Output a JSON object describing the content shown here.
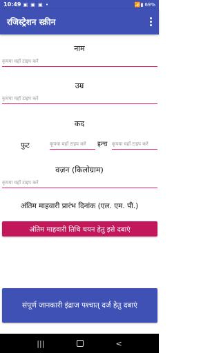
{
  "status_bar": {
    "time": "10:49",
    "left_icons": "▣ ▣ ▣ •",
    "right_icons": "📶▮",
    "battery": "69%"
  },
  "app_bar": {
    "title": "रजिस्ट्रेशन स्क्रीन"
  },
  "form": {
    "name_label": "नाम",
    "name_placeholder": "कृपया यहाँ टाइप करें",
    "age_label": "उम्र",
    "age_placeholder": "कृपया यहाँ टाइप करें",
    "height_label": "कद",
    "feet_label": "फुट",
    "feet_placeholder": "कृपया यहाँ टाइप करें",
    "inch_label": "इन्च",
    "inch_placeholder": "कृपया यहाँ टाइप करें",
    "weight_label": "वज़न (किलोग्राम)",
    "weight_placeholder": "कृपया यहाँ टाइप करें",
    "lmp_label": "अंतिम माहवारी प्रारंभ दिनांक (एल. एम. पी.)",
    "lmp_button": "अंतिम माहवारी तिथि चयन हेतु इसे दबाएं"
  },
  "submit_button": "संपूर्ण जानकारी इंद्राज पश्चात् दर्ज हेतु दबाएं",
  "nav_bar": {
    "recents": "|||",
    "back": "<"
  }
}
